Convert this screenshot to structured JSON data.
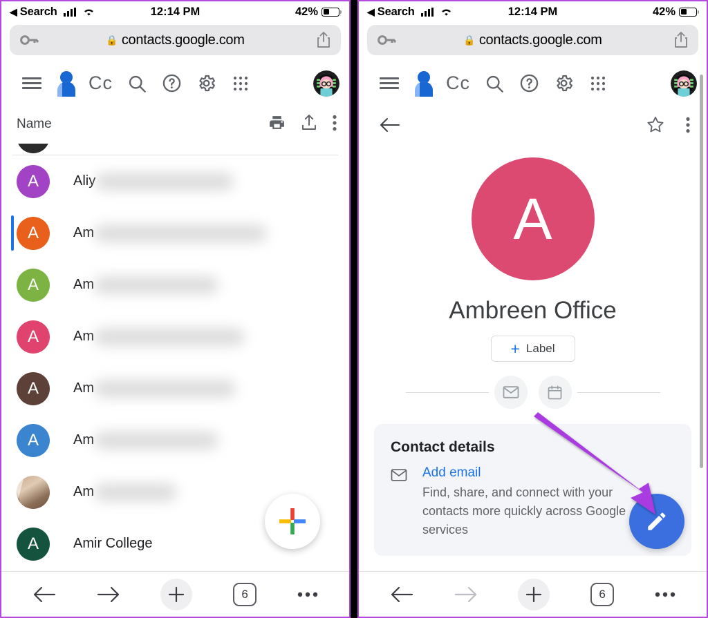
{
  "status_bar": {
    "back_label": "Search",
    "time": "12:14 PM",
    "battery_pct": "42%"
  },
  "url_bar": {
    "url": "contacts.google.com",
    "lock_glyph": "\u0000"
  },
  "app_header": {
    "logo_text": "Cc",
    "icons": [
      "menu-icon",
      "contacts-person-icon",
      "search-icon",
      "help-icon",
      "settings-icon",
      "apps-grid-icon",
      "account-avatar"
    ]
  },
  "left_panel": {
    "list_header": {
      "name_column": "Name",
      "actions": [
        "print-icon",
        "export-icon",
        "more-options-icon"
      ]
    },
    "contacts": [
      {
        "name": "Aliy",
        "redacted": true,
        "avatar_letter": "A",
        "color": "#A143C4",
        "selected": false,
        "blur_width": 200
      },
      {
        "name": "Am",
        "redacted": true,
        "avatar_letter": "A",
        "color": "#E8601C",
        "selected": true,
        "blur_width": 250
      },
      {
        "name": "Am",
        "redacted": true,
        "avatar_letter": "A",
        "color": "#7CB342",
        "selected": false,
        "blur_width": 180
      },
      {
        "name": "Am",
        "redacted": true,
        "avatar_letter": "A",
        "color": "#E0436E",
        "selected": false,
        "blur_width": 218
      },
      {
        "name": "Am",
        "redacted": true,
        "avatar_letter": "A",
        "color": "#5D4037",
        "selected": false,
        "blur_width": 205
      },
      {
        "name": "Am",
        "redacted": true,
        "avatar_letter": "A",
        "color": "#3B84D0",
        "selected": false,
        "blur_width": 180
      },
      {
        "name": "Am",
        "redacted": true,
        "avatar_letter": "",
        "color": "photo",
        "selected": false,
        "blur_width": 120
      },
      {
        "name": "Amir College",
        "redacted": false,
        "avatar_letter": "A",
        "color": "#14543F",
        "selected": false,
        "blur_width": 0
      }
    ],
    "fab": {
      "name": "create-contact-fab",
      "glyph": "+"
    }
  },
  "right_panel": {
    "toolbar": {
      "back": "back-arrow-icon",
      "star": "favorite-star-icon",
      "more": "more-options-icon"
    },
    "contact": {
      "avatar_letter": "A",
      "avatar_color": "#DC4A72",
      "display_name": "Ambreen Office",
      "label_button": "Label",
      "label_plus": "+",
      "quick_actions": [
        "email-icon",
        "calendar-icon"
      ]
    },
    "details_card": {
      "title": "Contact details",
      "add_email_link": "Add email",
      "description": "Find, share, and connect with your contacts more quickly across Google services"
    },
    "edit_fab": {
      "name": "edit-contact-fab",
      "icon": "pencil-icon",
      "color": "#3B6FE0"
    },
    "annotation": {
      "type": "arrow",
      "color": "#A93AE0"
    }
  },
  "browser_toolbar": {
    "back": "back-arrow-icon",
    "forward": "forward-arrow-icon",
    "new_tab": "+",
    "tab_count": "6",
    "more": "more-options-icon"
  },
  "colors": {
    "accent_blue": "#1a73e8",
    "fab_blue": "#3B6FE0",
    "annotation_purple": "#A93AE0",
    "frame_purple": "#b44ae0"
  }
}
